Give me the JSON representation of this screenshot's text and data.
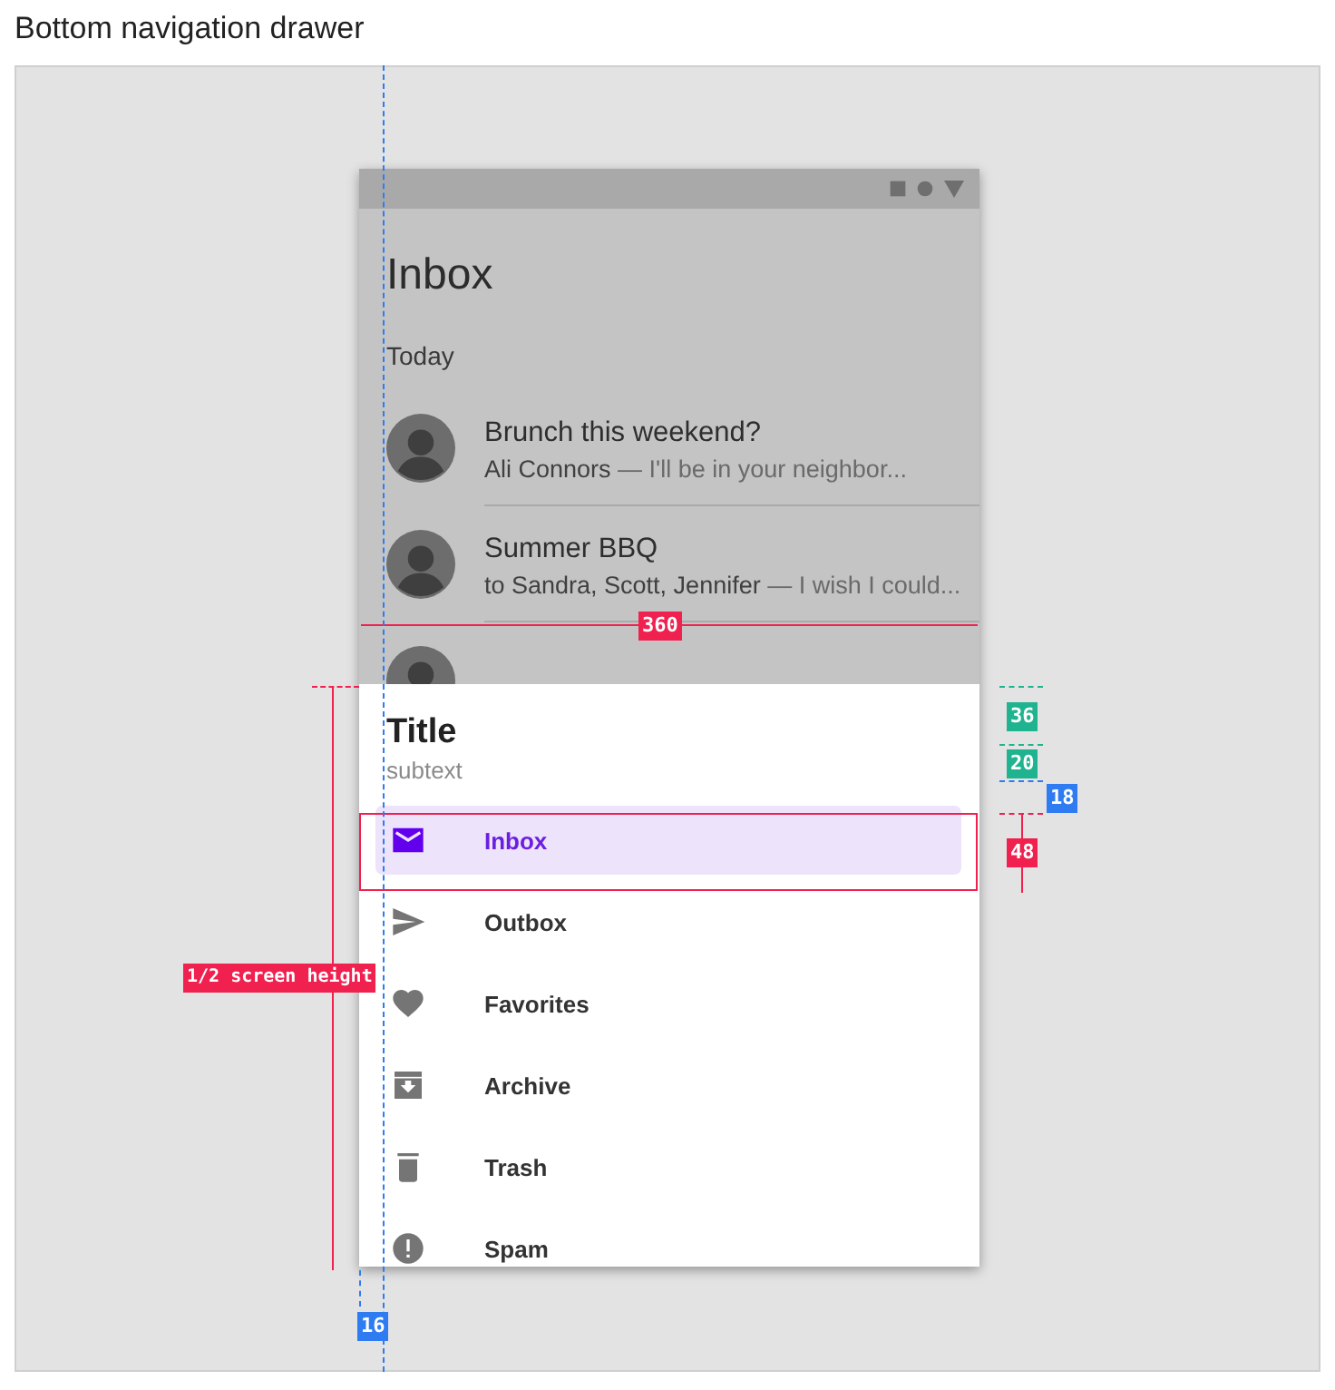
{
  "page_title": "Bottom navigation drawer",
  "screen": {
    "heading": "Inbox",
    "section": "Today",
    "messages": [
      {
        "title": "Brunch this weekend?",
        "sender": "Ali Connors",
        "preview": " — I'll be in your neighbor..."
      },
      {
        "title": "Summer BBQ",
        "sender": "to Sandra, Scott, Jennifer",
        "preview": " — I wish I could..."
      },
      {
        "partial": true
      }
    ]
  },
  "drawer": {
    "title": "Title",
    "subtext": "subtext",
    "items": [
      {
        "label": "Inbox",
        "selected": true
      },
      {
        "label": "Outbox",
        "selected": false
      },
      {
        "label": "Favorites",
        "selected": false
      },
      {
        "label": "Archive",
        "selected": false
      },
      {
        "label": "Trash",
        "selected": false
      },
      {
        "label": "Spam",
        "selected": false
      }
    ]
  },
  "annotations": [
    {
      "text": "360",
      "color": "#f0204f"
    },
    {
      "text": "1/2 screen height",
      "color": "#f0204f"
    },
    {
      "text": "36",
      "color": "#1fb38f"
    },
    {
      "text": "20",
      "color": "#1fb38f"
    },
    {
      "text": "18",
      "color": "#2f7cf2"
    },
    {
      "text": "48",
      "color": "#f0204f"
    },
    {
      "text": "16",
      "color": "#2f7cf2"
    }
  ]
}
